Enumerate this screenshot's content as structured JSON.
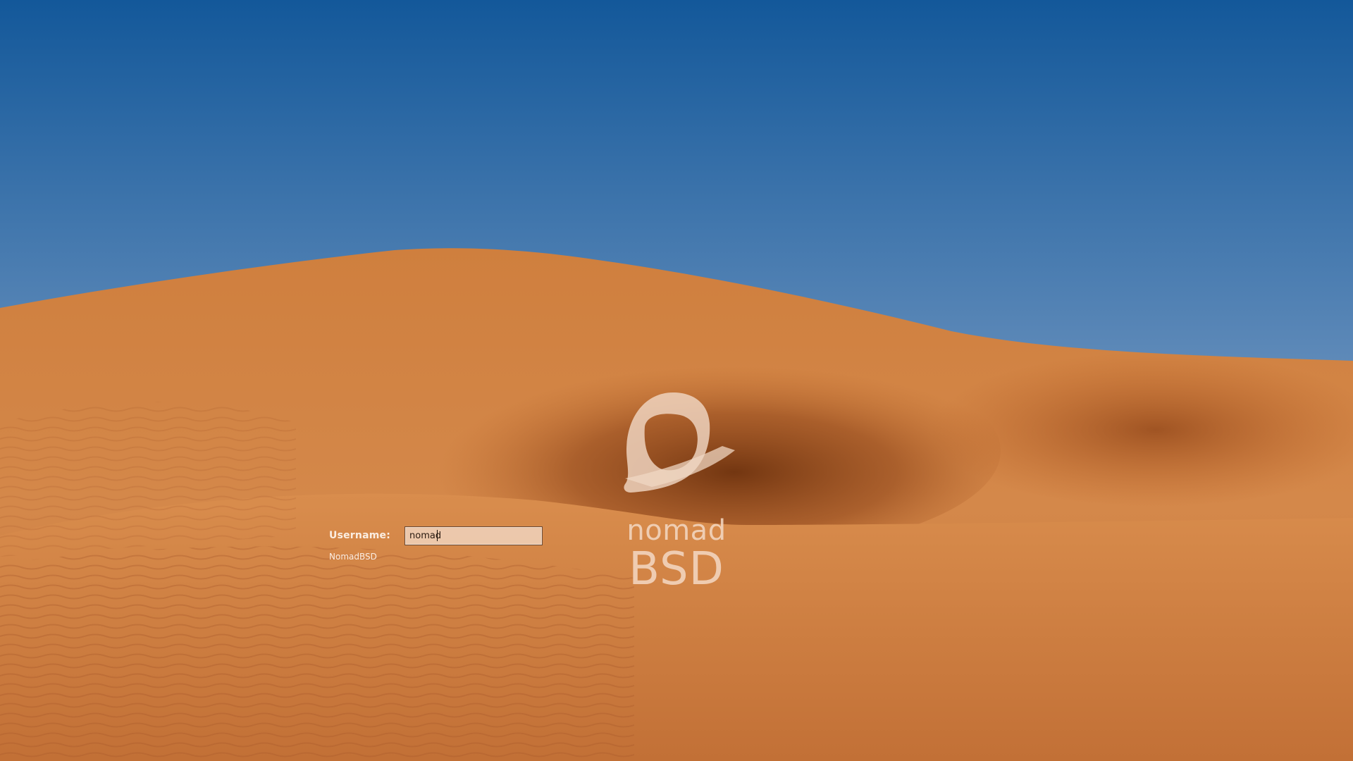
{
  "login": {
    "username_label": "Username:",
    "username_value": "nomad",
    "hostname": "NomadBSD"
  },
  "branding": {
    "word_top": "nomad",
    "word_bottom": "BSD"
  },
  "colors": {
    "sky_top": "#15599a",
    "sky_horizon": "#a9bad0",
    "dune_light": "#d9894a",
    "dune_shadow": "#7a3a12",
    "text_light": "#fbeee2"
  }
}
